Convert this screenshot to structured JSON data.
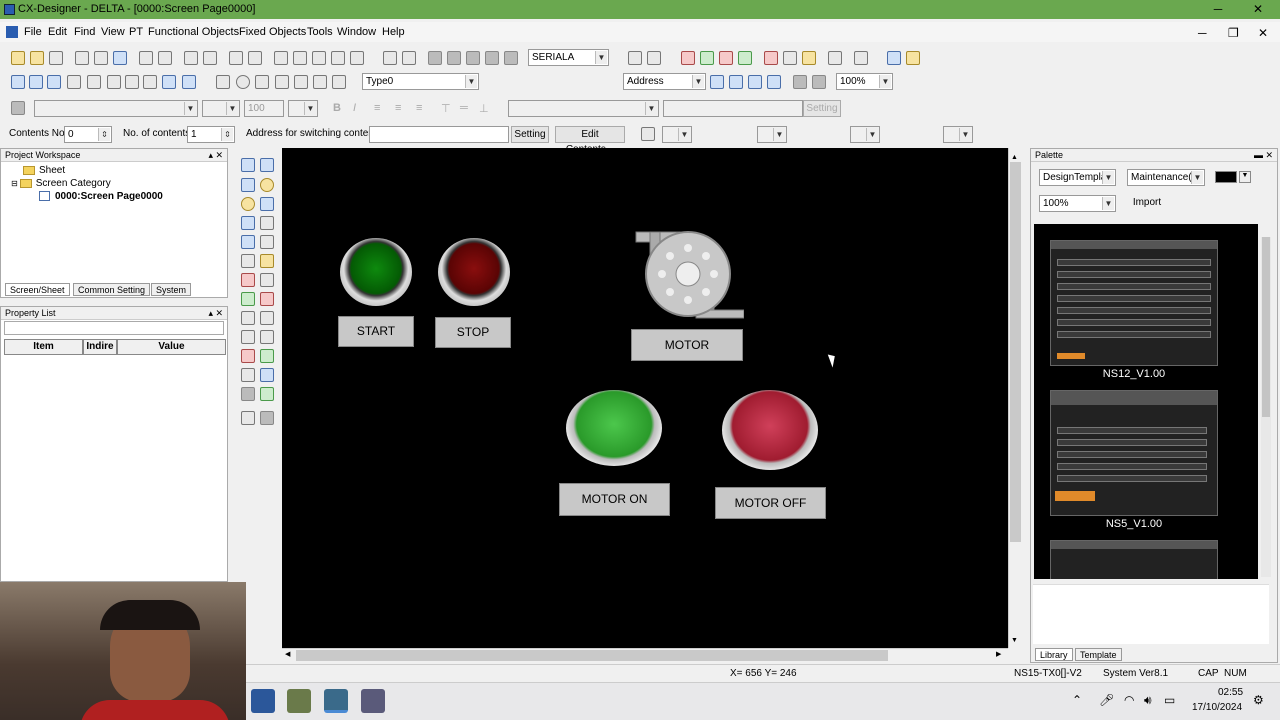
{
  "titlebar": {
    "title": "CX-Designer - DELTA - [0000:Screen Page0000]",
    "minimize": "─",
    "maximize": "❐",
    "close": "✕"
  },
  "menu": [
    "File",
    "Edit",
    "Find",
    "View",
    "PT",
    "Functional Objects",
    "Fixed Objects",
    "Tools",
    "Window",
    "Help"
  ],
  "toolbar": {
    "serial_select": "SERIALA",
    "type_select": "Type0",
    "address_select": "Address",
    "zoom_select": "100%",
    "font_size": "100",
    "setting_disabled": "Setting"
  },
  "contents_bar": {
    "contents_no_label": "Contents No.",
    "contents_no_value": "0",
    "no_of_contents_label": "No. of contents",
    "no_of_contents_value": "1",
    "address_label": "Address for switching contents",
    "setting_button": "Setting",
    "edit_contents_button": "Edit Contents..."
  },
  "workspace": {
    "title": "Project Workspace",
    "tree": [
      "Sheet",
      "Screen Category",
      "0000:Screen Page0000"
    ],
    "tabs": [
      "Screen/Sheet",
      "Common Setting",
      "System"
    ]
  },
  "property_list": {
    "title": "Property List",
    "columns": [
      "Item",
      "Indire",
      "Value"
    ]
  },
  "screen": {
    "start_label": "START",
    "stop_label": "STOP",
    "motor_label": "MOTOR",
    "motor_on_label": "MOTOR ON",
    "motor_off_label": "MOTOR OFF"
  },
  "palette": {
    "title": "Palette",
    "design_select": "DesignTemplat",
    "category_select": "Maintenance(C",
    "zoom_select": "100%",
    "import_button": "Import",
    "templates": [
      "NS12_V1.00",
      "NS5_V1.00"
    ],
    "tabs": [
      "Library",
      "Template"
    ]
  },
  "statusbar": {
    "coords": "X= 656 Y= 246",
    "model": "NS15-TX0[]-V2",
    "version": "System Ver8.1",
    "cap": "CAP",
    "num": "NUM"
  },
  "taskbar": {
    "time": "02:55",
    "date": "17/10/2024"
  },
  "colors": {
    "titlebar": "#6aa84f",
    "canvas": "#000000"
  }
}
